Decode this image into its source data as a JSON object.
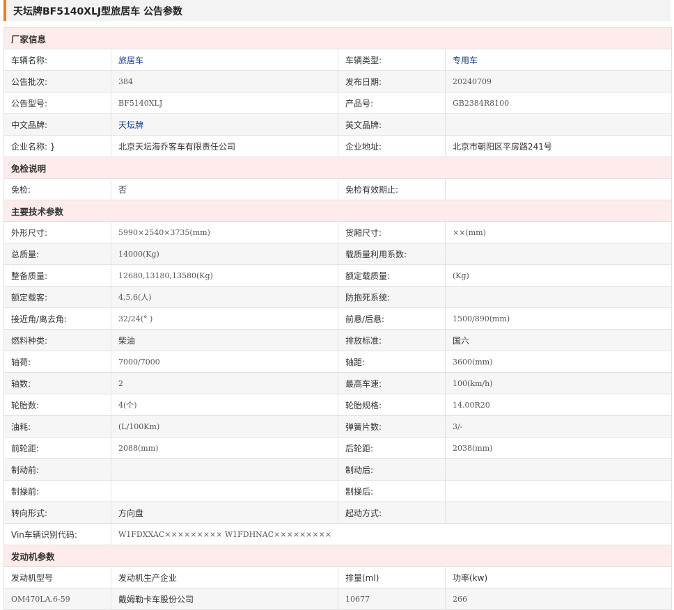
{
  "page_title": "天坛牌BF5140XLJ型旅居车 公告参数",
  "sections": {
    "manufacturer": "厂家信息",
    "exemption": "免检说明",
    "main_tech": "主要技术参数",
    "engine": "发动机参数"
  },
  "manufacturer": {
    "vehicle_name_label": "车辆名称:",
    "vehicle_name": "旅居车",
    "vehicle_type_label": "车辆类型:",
    "vehicle_type": "专用车",
    "batch_label": "公告批次:",
    "batch": "384",
    "release_date_label": "发布日期:",
    "release_date": "20240709",
    "model_label": "公告型号:",
    "model": "BF5140XLJ",
    "product_no_label": "产品号:",
    "product_no": "GB2384R8100",
    "cn_brand_label": "中文品牌:",
    "cn_brand": "天坛牌",
    "en_brand_label": "英文品牌:",
    "en_brand": "",
    "company_label": "企业名称: }",
    "company": "北京天坛海乔客车有限责任公司",
    "address_label": "企业地址:",
    "address": "北京市朝阳区平房路241号"
  },
  "exemption": {
    "exempt_label": "免检:",
    "exempt": "否",
    "validity_label": "免检有效期止:",
    "validity": ""
  },
  "main_tech": [
    {
      "l1": "外形尺寸:",
      "v1": "5990×2540×3735(mm)",
      "l2": "货厢尺寸:",
      "v2": "××(mm)"
    },
    {
      "l1": "总质量:",
      "v1": "14000(Kg)",
      "l2": "载质量利用系数:",
      "v2": ""
    },
    {
      "l1": "整备质量:",
      "v1": "12680,13180,13580(Kg)",
      "l2": "额定载质量:",
      "v2": "(Kg)"
    },
    {
      "l1": "额定载客:",
      "v1": "4,5,6(人)",
      "l2": "防抱死系统:",
      "v2": ""
    },
    {
      "l1": "接近角/离去角:",
      "v1": "32/24(° )",
      "l2": "前悬/后悬:",
      "v2": "1500/890(mm)"
    },
    {
      "l1": "燃料种类:",
      "v1": "柴油",
      "l2": "排放标准:",
      "v2": "国六"
    },
    {
      "l1": "轴荷:",
      "v1": "7000/7000",
      "l2": "轴距:",
      "v2": "3600(mm)"
    },
    {
      "l1": "轴数:",
      "v1": "2",
      "l2": "最高车速:",
      "v2": "100(km/h)"
    },
    {
      "l1": "轮胎数:",
      "v1": "4(个)",
      "l2": "轮胎规格:",
      "v2": "14.00R20"
    },
    {
      "l1": "油耗:",
      "v1": "(L/100Km)",
      "l2": "弹簧片数:",
      "v2": "3/-"
    },
    {
      "l1": "前轮距:",
      "v1": "2088(mm)",
      "l2": "后轮距:",
      "v2": "2038(mm)"
    },
    {
      "l1": "制动前:",
      "v1": "",
      "l2": "制动后:",
      "v2": ""
    },
    {
      "l1": "制操前:",
      "v1": "",
      "l2": "制操后:",
      "v2": ""
    },
    {
      "l1": "转向形式:",
      "v1": "方向盘",
      "l2": "起动方式:",
      "v2": ""
    }
  ],
  "vin": {
    "label": "Vin车辆识别代码:",
    "value": "W1FDXXAC××××××××× W1FDHNAC×××××××××"
  },
  "engine": {
    "h_model": "发动机型号",
    "h_maker": "发动机生产企业",
    "h_displacement": "排量(ml)",
    "h_power": "功率(kw)",
    "model": "OM470LA.6-59",
    "maker": "戴姆勒卡车股份公司",
    "displacement": "10677",
    "power": "266"
  }
}
